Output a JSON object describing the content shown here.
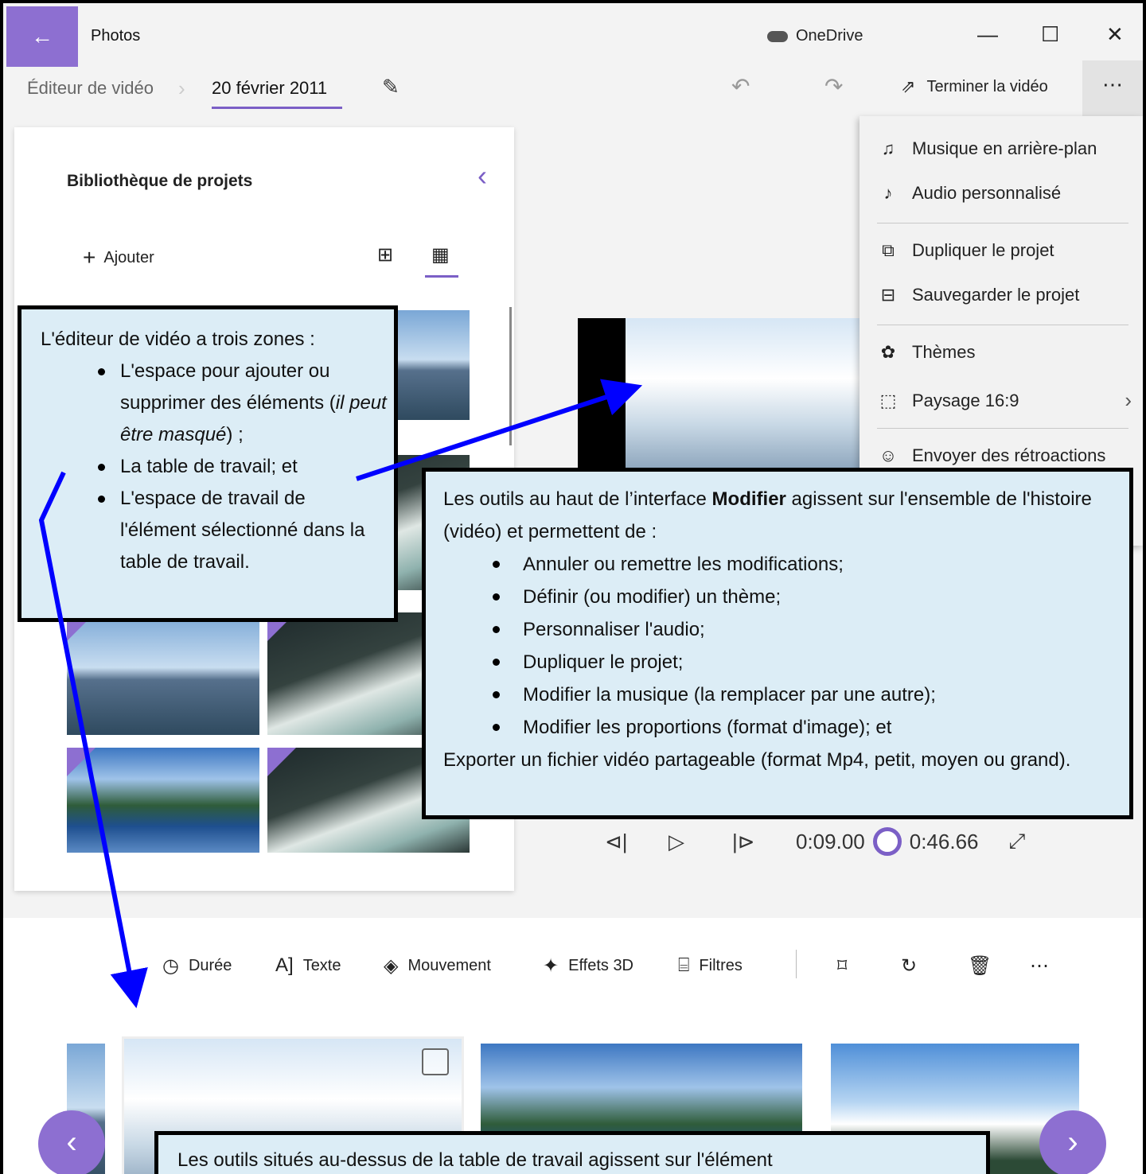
{
  "titlebar": {
    "app_title": "Photos",
    "onedrive": "OneDrive",
    "back_icon": "arrow-left-icon",
    "minimize": "—",
    "maximize": "☐",
    "close": "✕"
  },
  "breadcrumb": {
    "parent": "Éditeur de vidéo",
    "current": "20 février 2011"
  },
  "header_actions": {
    "finish": "Terminer la vidéo",
    "more": "⋯"
  },
  "library": {
    "title": "Bibliothèque de projets",
    "add": "Ajouter"
  },
  "menu": {
    "items": [
      {
        "label": "Musique en arrière-plan",
        "icon": "music-note-icon"
      },
      {
        "label": "Audio personnalisé",
        "icon": "custom-audio-icon"
      },
      {
        "label": "Dupliquer le projet",
        "icon": "duplicate-icon"
      },
      {
        "label": "Sauvegarder le projet",
        "icon": "save-project-icon"
      },
      {
        "label": "Thèmes",
        "icon": "palette-icon"
      },
      {
        "label": "Paysage 16:9",
        "icon": "aspect-ratio-icon"
      },
      {
        "label": "Envoyer des rétroactions",
        "icon": "feedback-icon"
      }
    ]
  },
  "playback": {
    "current_time": "0:09.00",
    "total_time": "0:46.66"
  },
  "toolbar": {
    "duration": "Durée",
    "text": "Texte",
    "motion": "Mouvement",
    "effects3d": "Effets 3D",
    "filters": "Filtres"
  },
  "callouts": {
    "zones": {
      "intro": "L'éditeur de vidéo a trois zones :",
      "b1_a": "L'espace pour ajouter ou supprimer des éléments (",
      "b1_em": "il peut être masqué",
      "b1_b": ") ;",
      "b2": "La table de travail; et",
      "b3": "L'espace de travail de l'élément sélectionné dans la table de travail."
    },
    "tools": {
      "intro_a": "Les outils au haut de l’interface ",
      "intro_bold": "Modifier",
      "intro_b": " agissent sur l'ensemble de l'histoire (vidéo) et permettent de :",
      "items": [
        "Annuler ou remettre les modifications;",
        "Définir (ou modifier) un thème;",
        "Personnaliser l'audio;",
        "Dupliquer le projet;",
        "Modifier la musique (la remplacer par une autre);",
        "Modifier les proportions (format d'image); et"
      ],
      "outro": "Exporter un fichier vidéo partageable (format Mp4, petit, moyen ou grand)."
    },
    "workbench": "Les outils situés au-dessus de la table de travail agissent sur l'élément"
  },
  "colors": {
    "accent": "#7b5fc6",
    "callout_bg": "#dcedf6",
    "arrow": "#0000ff"
  }
}
